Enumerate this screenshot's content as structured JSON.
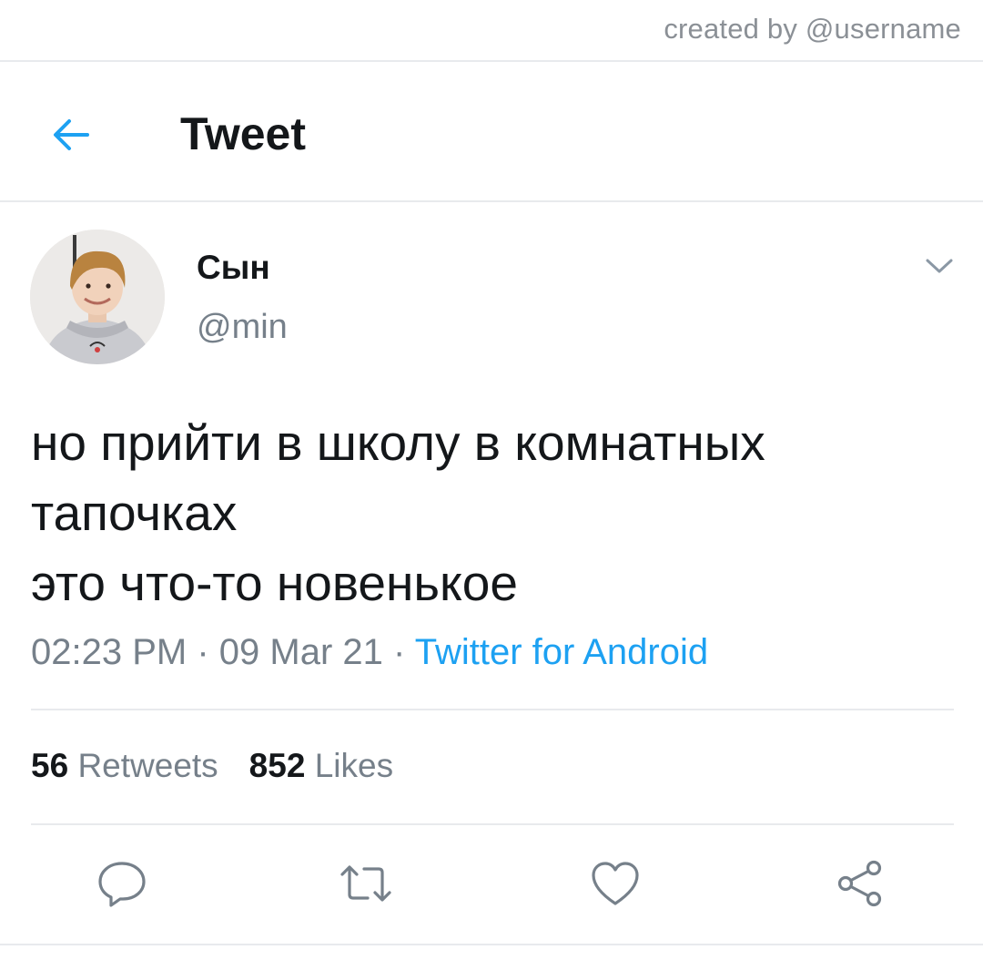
{
  "credit": "created by @username",
  "header": {
    "title": "Tweet",
    "back_icon": "arrow-left-icon"
  },
  "tweet": {
    "display_name": "Сын",
    "handle": "@min",
    "text_lines": [
      "но прийти в школу в комнатных",
      "тапочках",
      "это что-то новенькое"
    ],
    "time": "02:23 PM",
    "separator": "·",
    "date": "09 Mar 21",
    "source": "Twitter for Android",
    "retweets_count": "56",
    "retweets_label": "Retweets",
    "likes_count": "852",
    "likes_label": "Likes"
  },
  "actions": [
    "reply-icon",
    "retweet-icon",
    "like-icon",
    "share-icon"
  ],
  "colors": {
    "accent": "#1da1f2",
    "text_primary": "#14171a",
    "text_secondary": "#76808a",
    "divider": "#e8eaed"
  }
}
